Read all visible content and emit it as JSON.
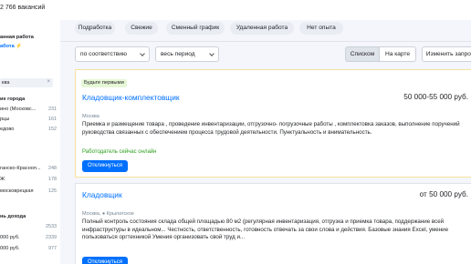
{
  "header": {
    "vacancy_count": "2 766 вакансий"
  },
  "sidebar": {
    "remote_heading": "анная работа",
    "remote_link": "абота ⚡",
    "region_heading": "",
    "region_value": "ква",
    "districts_heading": "ие города",
    "districts": [
      {
        "label": "ино (Московс...",
        "count": "231"
      },
      {
        "label": "рцы",
        "count": "161"
      },
      {
        "label": "едово",
        "count": "152"
      },
      {
        "label": "",
        "count": ""
      }
    ],
    "metro": [
      {
        "label": "ганско-Красноп...",
        "count": "248"
      },
      {
        "label": "Ж",
        "count": "178"
      },
      {
        "label": "московрецкая",
        "count": "125"
      },
      {
        "label": "",
        "count": ""
      }
    ],
    "income_heading": "нь дохода",
    "income": [
      {
        "label": "",
        "count": "2533"
      },
      {
        "label": "000 руб.",
        "count": "2339"
      },
      {
        "label": "000 руб.",
        "count": "977"
      },
      {
        "label": "",
        "count": ""
      }
    ]
  },
  "chips": [
    "Подработка",
    "Свежие",
    "Сменный график",
    "Удаленная работа",
    "Нет опыта"
  ],
  "filters": {
    "sort": "по соответствию",
    "period": "весь период"
  },
  "view": {
    "list": "Списком",
    "map": "На карте",
    "change": "Изменить запрос"
  },
  "vacancies": [
    {
      "badge": "Будьте первыми",
      "title": "Кладовщик-комплектовщик",
      "salary": "50 000-55 000 руб.",
      "city": "Москва",
      "description": "Приемка и размещение товара , проведение инвентаризации, отгрузочно- погрузочные работы , комплектовка заказов, выполнение поручений руководства связанных с обеспечением процесса трудовой деятельности. Пунктуальность и внимательность.",
      "online": "Работодатель сейчас онлайн",
      "respond": "Откликнуться"
    },
    {
      "title": "Кладовщик",
      "salary": "от 50 000 руб.",
      "city": "Москва, ● Крылатское",
      "description": "Полный контроль состояния склада общей площадью 80 м2 (регулярная инвентаризация, отгрузка и приемка товара, поддержание всей инфраструктуры в идеальном... Честность, ответственность, готовность отвечать за свои слова и действия. Базовые знания Excel, умение пользоваться оргтехникой Умения организовать свой труд и...",
      "respond": "Откликнуться"
    }
  ]
}
